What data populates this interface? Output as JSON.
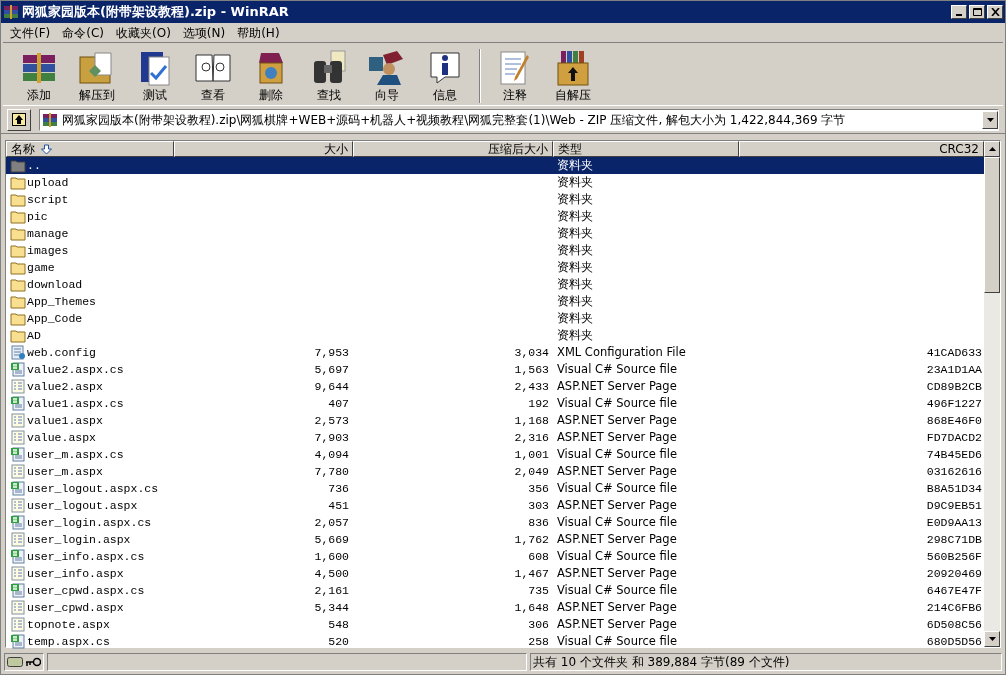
{
  "window": {
    "title": "网狐家园版本(附带架设教程).zip - WinRAR"
  },
  "menu": [
    "文件(F)",
    "命令(C)",
    "收藏夹(O)",
    "选项(N)",
    "帮助(H)"
  ],
  "toolbar": [
    {
      "kind": "add",
      "label": "添加"
    },
    {
      "kind": "extract",
      "label": "解压到"
    },
    {
      "kind": "test",
      "label": "测试"
    },
    {
      "kind": "view",
      "label": "查看"
    },
    {
      "kind": "delete",
      "label": "删除"
    },
    {
      "kind": "find",
      "label": "查找"
    },
    {
      "kind": "wizard",
      "label": "向导"
    },
    {
      "kind": "info",
      "label": "信息"
    },
    {
      "kind": "separator"
    },
    {
      "kind": "comment",
      "label": "注释"
    },
    {
      "kind": "sfx",
      "label": "自解压"
    }
  ],
  "address": {
    "value": "网狐家园版本(附带架设教程).zip\\网狐棋牌+WEB+源码+机器人+视频教程\\网狐完整套(1)\\Web - ZIP 压缩文件, 解包大小为 1,422,844,369 字节"
  },
  "table": {
    "columns": [
      "名称",
      "大小",
      "压缩后大小",
      "类型",
      "CRC32"
    ],
    "rows": [
      {
        "kind": "parent",
        "name": "..",
        "type": "资料夹",
        "selected": true
      },
      {
        "kind": "folder",
        "name": "upload",
        "type": "资料夹",
        "selected": false
      },
      {
        "kind": "folder",
        "name": "script",
        "type": "资料夹",
        "selected": false
      },
      {
        "kind": "folder",
        "name": "pic",
        "type": "资料夹",
        "selected": false
      },
      {
        "kind": "folder",
        "name": "manage",
        "type": "资料夹",
        "selected": false
      },
      {
        "kind": "folder",
        "name": "images",
        "type": "资料夹",
        "selected": false
      },
      {
        "kind": "folder",
        "name": "game",
        "type": "资料夹",
        "selected": false
      },
      {
        "kind": "folder",
        "name": "download",
        "type": "资料夹",
        "selected": false
      },
      {
        "kind": "folder",
        "name": "App_Themes",
        "type": "资料夹",
        "selected": false
      },
      {
        "kind": "folder",
        "name": "App_Code",
        "type": "资料夹",
        "selected": false
      },
      {
        "kind": "folder",
        "name": "AD",
        "type": "资料夹",
        "selected": false
      },
      {
        "kind": "config",
        "name": "web.config",
        "size": "7,953",
        "packed": "3,034",
        "type": "XML Configuration File",
        "crc": "41CAD633",
        "selected": false
      },
      {
        "kind": "cs",
        "name": "value2.aspx.cs",
        "size": "5,697",
        "packed": "1,563",
        "type": "Visual C# Source file",
        "crc": "23A1D1AA",
        "selected": false
      },
      {
        "kind": "aspx",
        "name": "value2.aspx",
        "size": "9,644",
        "packed": "2,433",
        "type": "ASP.NET Server Page",
        "crc": "CD89B2CB",
        "selected": false
      },
      {
        "kind": "cs",
        "name": "value1.aspx.cs",
        "size": "407",
        "packed": "192",
        "type": "Visual C# Source file",
        "crc": "496F1227",
        "selected": false
      },
      {
        "kind": "aspx",
        "name": "value1.aspx",
        "size": "2,573",
        "packed": "1,168",
        "type": "ASP.NET Server Page",
        "crc": "868E46F0",
        "selected": false
      },
      {
        "kind": "aspx",
        "name": "value.aspx",
        "size": "7,903",
        "packed": "2,316",
        "type": "ASP.NET Server Page",
        "crc": "FD7DACD2",
        "selected": false
      },
      {
        "kind": "cs",
        "name": "user_m.aspx.cs",
        "size": "4,094",
        "packed": "1,001",
        "type": "Visual C# Source file",
        "crc": "74B45ED6",
        "selected": false
      },
      {
        "kind": "aspx",
        "name": "user_m.aspx",
        "size": "7,780",
        "packed": "2,049",
        "type": "ASP.NET Server Page",
        "crc": "03162616",
        "selected": false
      },
      {
        "kind": "cs",
        "name": "user_logout.aspx.cs",
        "size": "736",
        "packed": "356",
        "type": "Visual C# Source file",
        "crc": "B8A51D34",
        "selected": false
      },
      {
        "kind": "aspx",
        "name": "user_logout.aspx",
        "size": "451",
        "packed": "303",
        "type": "ASP.NET Server Page",
        "crc": "D9C9EB51",
        "selected": false
      },
      {
        "kind": "cs",
        "name": "user_login.aspx.cs",
        "size": "2,057",
        "packed": "836",
        "type": "Visual C# Source file",
        "crc": "E0D9AA13",
        "selected": false
      },
      {
        "kind": "aspx",
        "name": "user_login.aspx",
        "size": "5,669",
        "packed": "1,762",
        "type": "ASP.NET Server Page",
        "crc": "298C71DB",
        "selected": false
      },
      {
        "kind": "cs",
        "name": "user_info.aspx.cs",
        "size": "1,600",
        "packed": "608",
        "type": "Visual C# Source file",
        "crc": "560B256F",
        "selected": false
      },
      {
        "kind": "aspx",
        "name": "user_info.aspx",
        "size": "4,500",
        "packed": "1,467",
        "type": "ASP.NET Server Page",
        "crc": "20920469",
        "selected": false
      },
      {
        "kind": "cs",
        "name": "user_cpwd.aspx.cs",
        "size": "2,161",
        "packed": "735",
        "type": "Visual C# Source file",
        "crc": "6467E47F",
        "selected": false
      },
      {
        "kind": "aspx",
        "name": "user_cpwd.aspx",
        "size": "5,344",
        "packed": "1,648",
        "type": "ASP.NET Server Page",
        "crc": "214C6FB6",
        "selected": false
      },
      {
        "kind": "aspx",
        "name": "topnote.aspx",
        "size": "548",
        "packed": "306",
        "type": "ASP.NET Server Page",
        "crc": "6D508C56",
        "selected": false
      },
      {
        "kind": "cs",
        "name": "temp.aspx.cs",
        "size": "520",
        "packed": "258",
        "type": "Visual C# Source file",
        "crc": "680D5D56",
        "selected": false
      }
    ]
  },
  "status_bar": {
    "text": "共有 10 个文件夹 和 389,884 字节(89 个文件)"
  }
}
